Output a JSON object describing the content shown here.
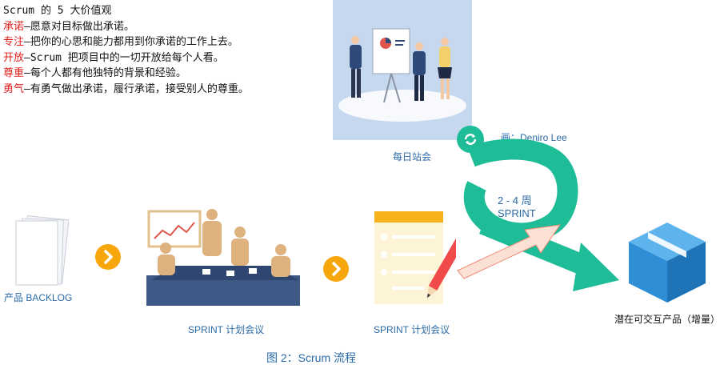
{
  "values_block": {
    "title": "Scrum 的 5 大价值观",
    "items": [
      {
        "key": "承诺",
        "text": "—愿意对目标做出承诺。"
      },
      {
        "key": "专注",
        "text": "—把你的心思和能力都用到你承诺的工作上去。"
      },
      {
        "key": "开放",
        "text": "—Scrum 把项目中的一切开放给每个人看。"
      },
      {
        "key": "尊重",
        "text": "—每个人都有他独特的背景和经验。"
      },
      {
        "key": "勇气",
        "text": "—有勇气做出承诺，履行承诺，接受别人的尊重。"
      }
    ]
  },
  "labels": {
    "daily_scrum": "每日站会",
    "credit": "画：Deniro Lee",
    "sprint_duration": "2 - 4 周",
    "sprint": "SPRINT",
    "product_backlog": "产品 BACKLOG",
    "sprint_planning": "SPRINT 计划会议",
    "sprint_backlog": "SPRINT 计划会议",
    "increment": "潜在可交互产品（增量）",
    "figure_caption": "图 2：Scrum 流程"
  },
  "colors": {
    "accent_orange": "#f7a60b",
    "sprint_teal": "#1fbc98",
    "box_blue": "#2f8fd6",
    "highlight_red": "#e0201e",
    "text_blue": "#2b6aa8"
  }
}
